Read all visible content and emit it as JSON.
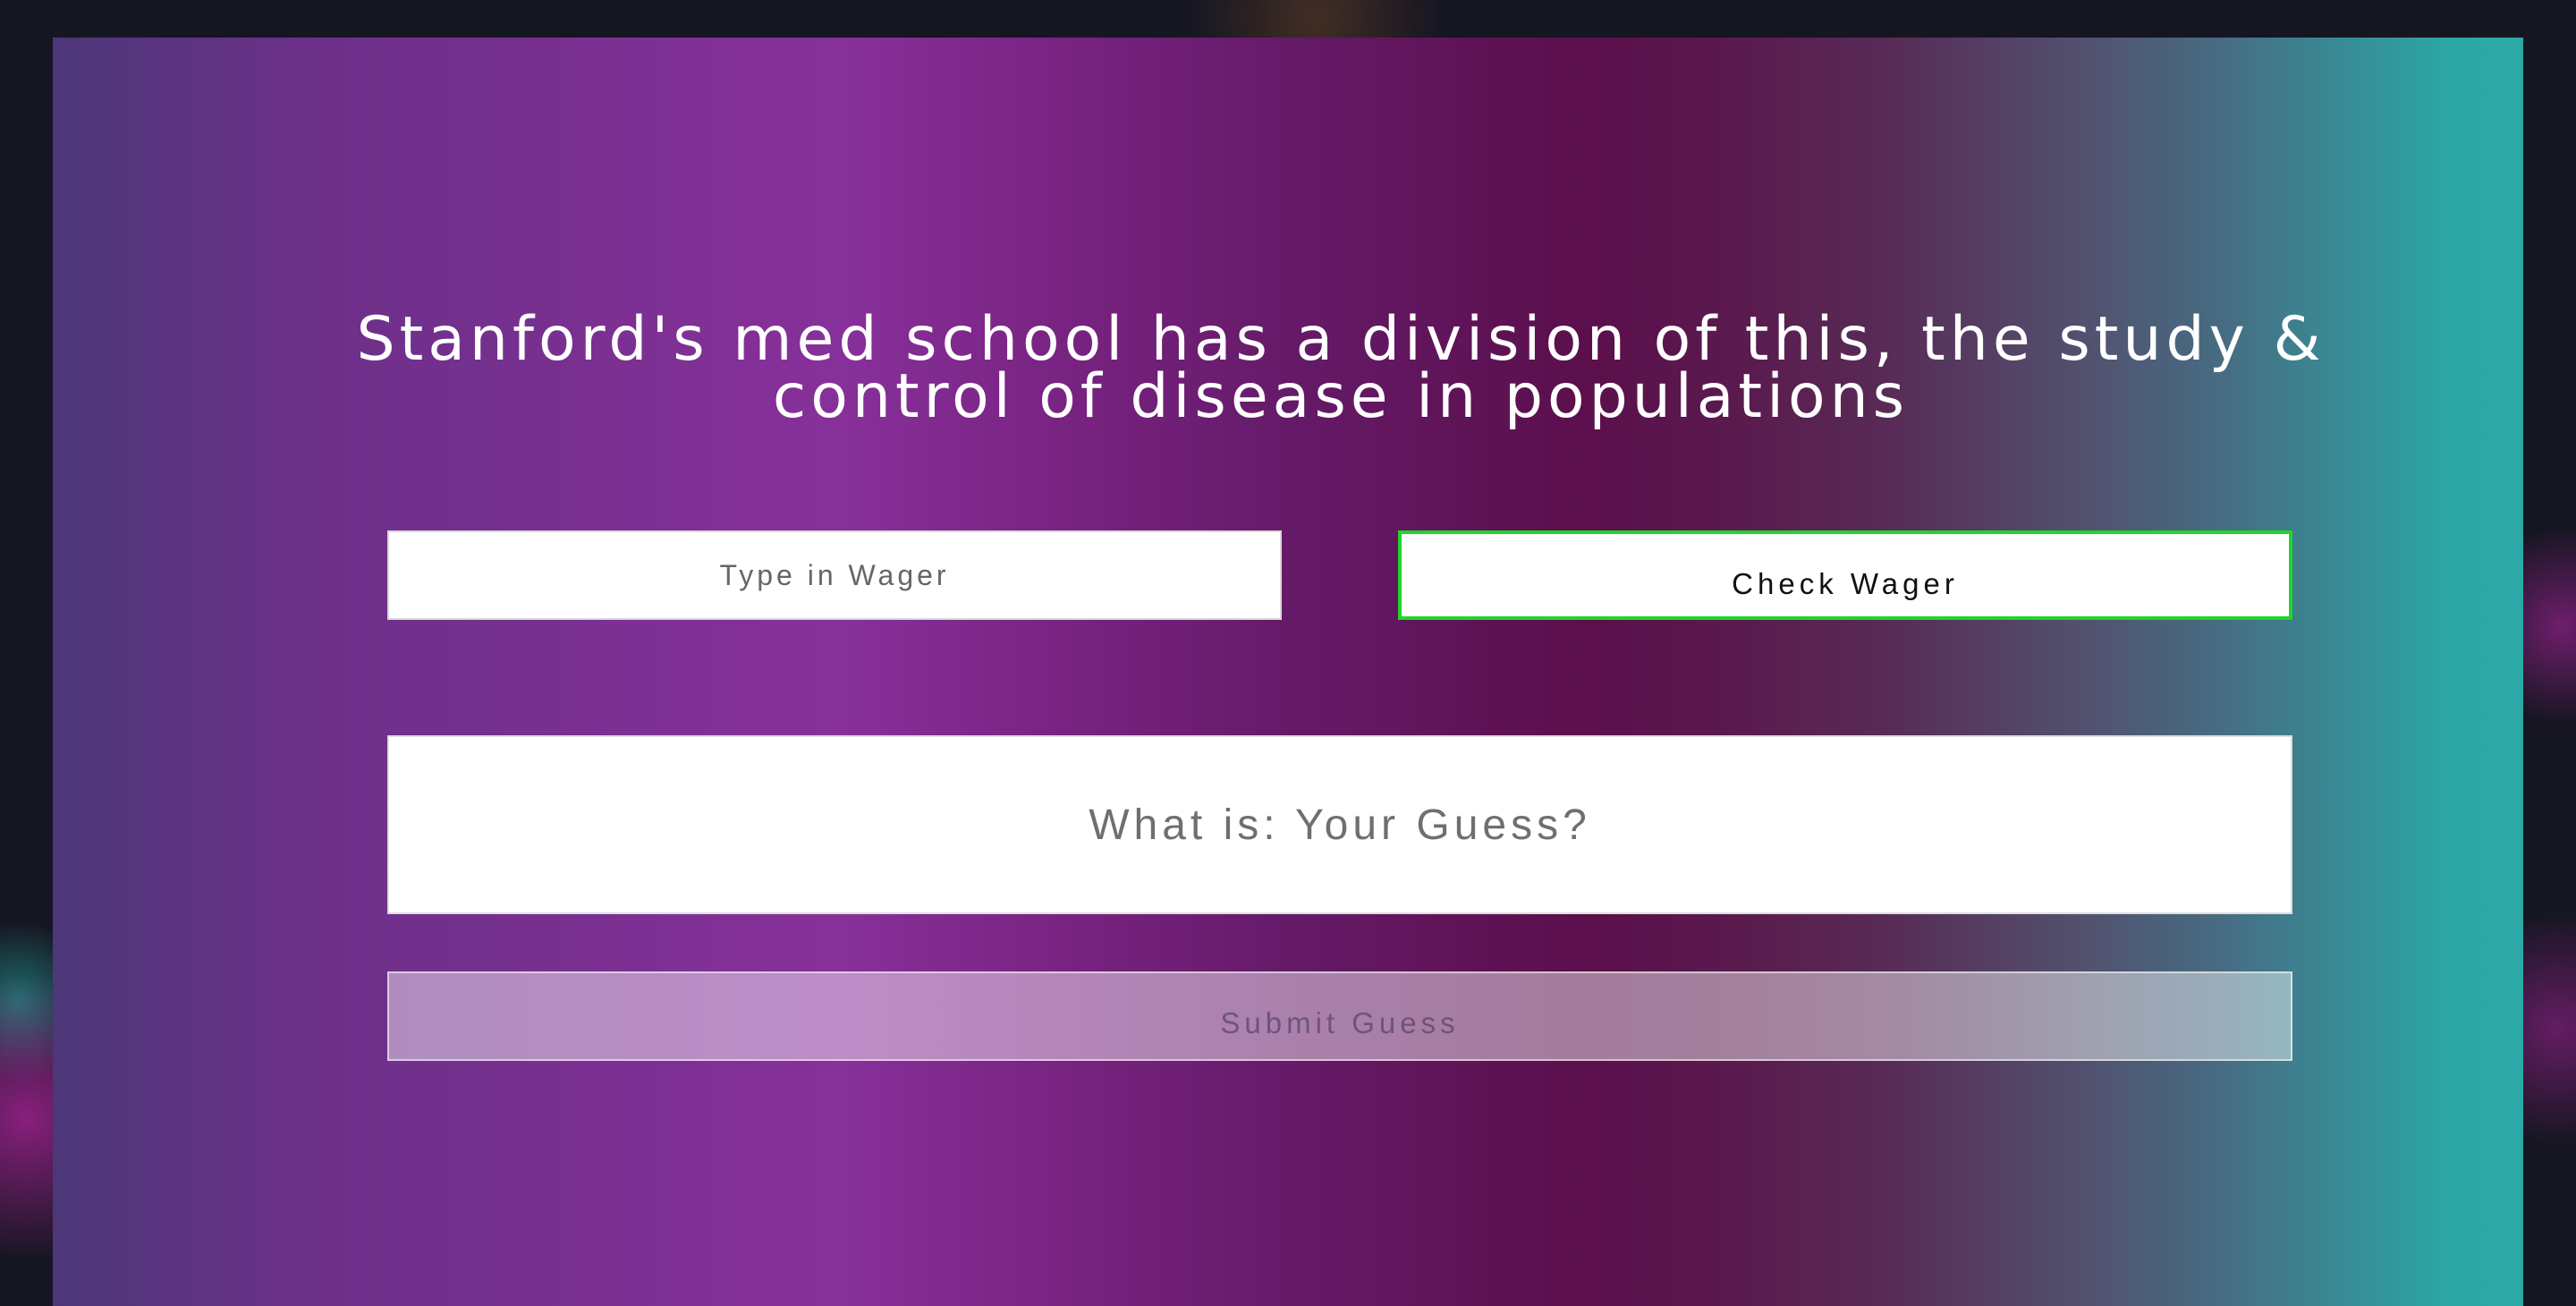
{
  "question": {
    "text": "Stanford's med school has a division of this, the study & control of disease in populations"
  },
  "wager": {
    "placeholder": "Type in Wager",
    "value": ""
  },
  "check_wager": {
    "label": "Check Wager",
    "border_color": "#1fd62a"
  },
  "guess": {
    "placeholder": "What is: Your Guess?",
    "value": ""
  },
  "submit_guess": {
    "label": "Submit Guess",
    "state": "disabled"
  },
  "colors": {
    "gradient": [
      "#4c3778",
      "#87309a",
      "#5b0f4c",
      "#2ca9a7"
    ],
    "question_text": "#ffffff"
  }
}
